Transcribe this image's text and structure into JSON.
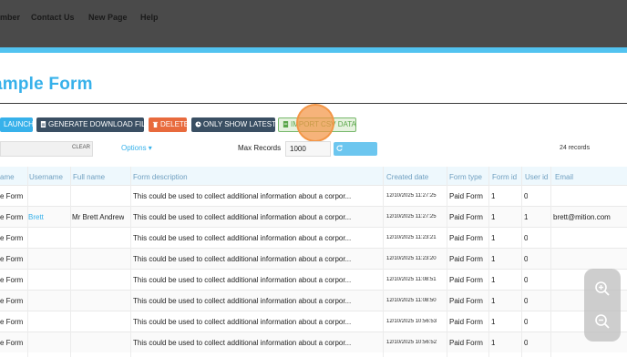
{
  "nav": {
    "items": [
      "mber",
      "Contact Us",
      "New Page",
      "Help"
    ]
  },
  "page": {
    "title": "ample Form"
  },
  "toolbar": {
    "launch": "LAUNCH",
    "generate": "GENERATE DOWNLOAD FILE",
    "delete": "DELETE",
    "latest": "ONLY SHOW LATEST",
    "import": "IMPORT CSV DATA"
  },
  "filters": {
    "clear": "CLEAR",
    "options": "Options ▾",
    "max_label": "Max Records",
    "max_value": "1000",
    "refresh": "REFRESH",
    "count": "24 records"
  },
  "table": {
    "headers": [
      "ame",
      "Username",
      "Full name",
      "Form description",
      "Created date",
      "Form type",
      "Form id",
      "User id",
      "Email"
    ],
    "rows": [
      [
        "e Form",
        "",
        "",
        "This could be used to collect additional information about a corpor...",
        "12/10/2025 11:27:25",
        "Paid Form",
        "1",
        "0",
        ""
      ],
      [
        "e Form",
        "Brett",
        "Mr Brett Andrew",
        "This could be used to collect additional information about a corpor...",
        "12/10/2025 11:27:25",
        "Paid Form",
        "1",
        "1",
        "brett@mition.com"
      ],
      [
        "e Form",
        "",
        "",
        "This could be used to collect additional information about a corpor...",
        "12/10/2025 11:23:21",
        "Paid Form",
        "1",
        "0",
        ""
      ],
      [
        "e Form",
        "",
        "",
        "This could be used to collect additional information about a corpor...",
        "12/10/2025 11:23:20",
        "Paid Form",
        "1",
        "0",
        ""
      ],
      [
        "e Form",
        "",
        "",
        "This could be used to collect additional information about a corpor...",
        "12/10/2025 11:08:51",
        "Paid Form",
        "1",
        "0",
        ""
      ],
      [
        "e Form",
        "",
        "",
        "This could be used to collect additional information about a corpor...",
        "12/10/2025 11:08:50",
        "Paid Form",
        "1",
        "0",
        ""
      ],
      [
        "e Form",
        "",
        "",
        "This could be used to collect additional information about a corpor...",
        "12/10/2025 10:56:53",
        "Paid Form",
        "1",
        "0",
        ""
      ],
      [
        "e Form",
        "",
        "",
        "This could be used to collect additional information about a corpor...",
        "12/10/2025 10:56:52",
        "Paid Form",
        "1",
        "0",
        ""
      ]
    ]
  },
  "icons": {
    "zoom_in": "zoom-in-icon",
    "zoom_out": "zoom-out-icon"
  },
  "colors": {
    "accent": "#37b1ea",
    "dark_button": "#3a4f63",
    "danger": "#e86a3d",
    "highlight": "#f39646"
  }
}
